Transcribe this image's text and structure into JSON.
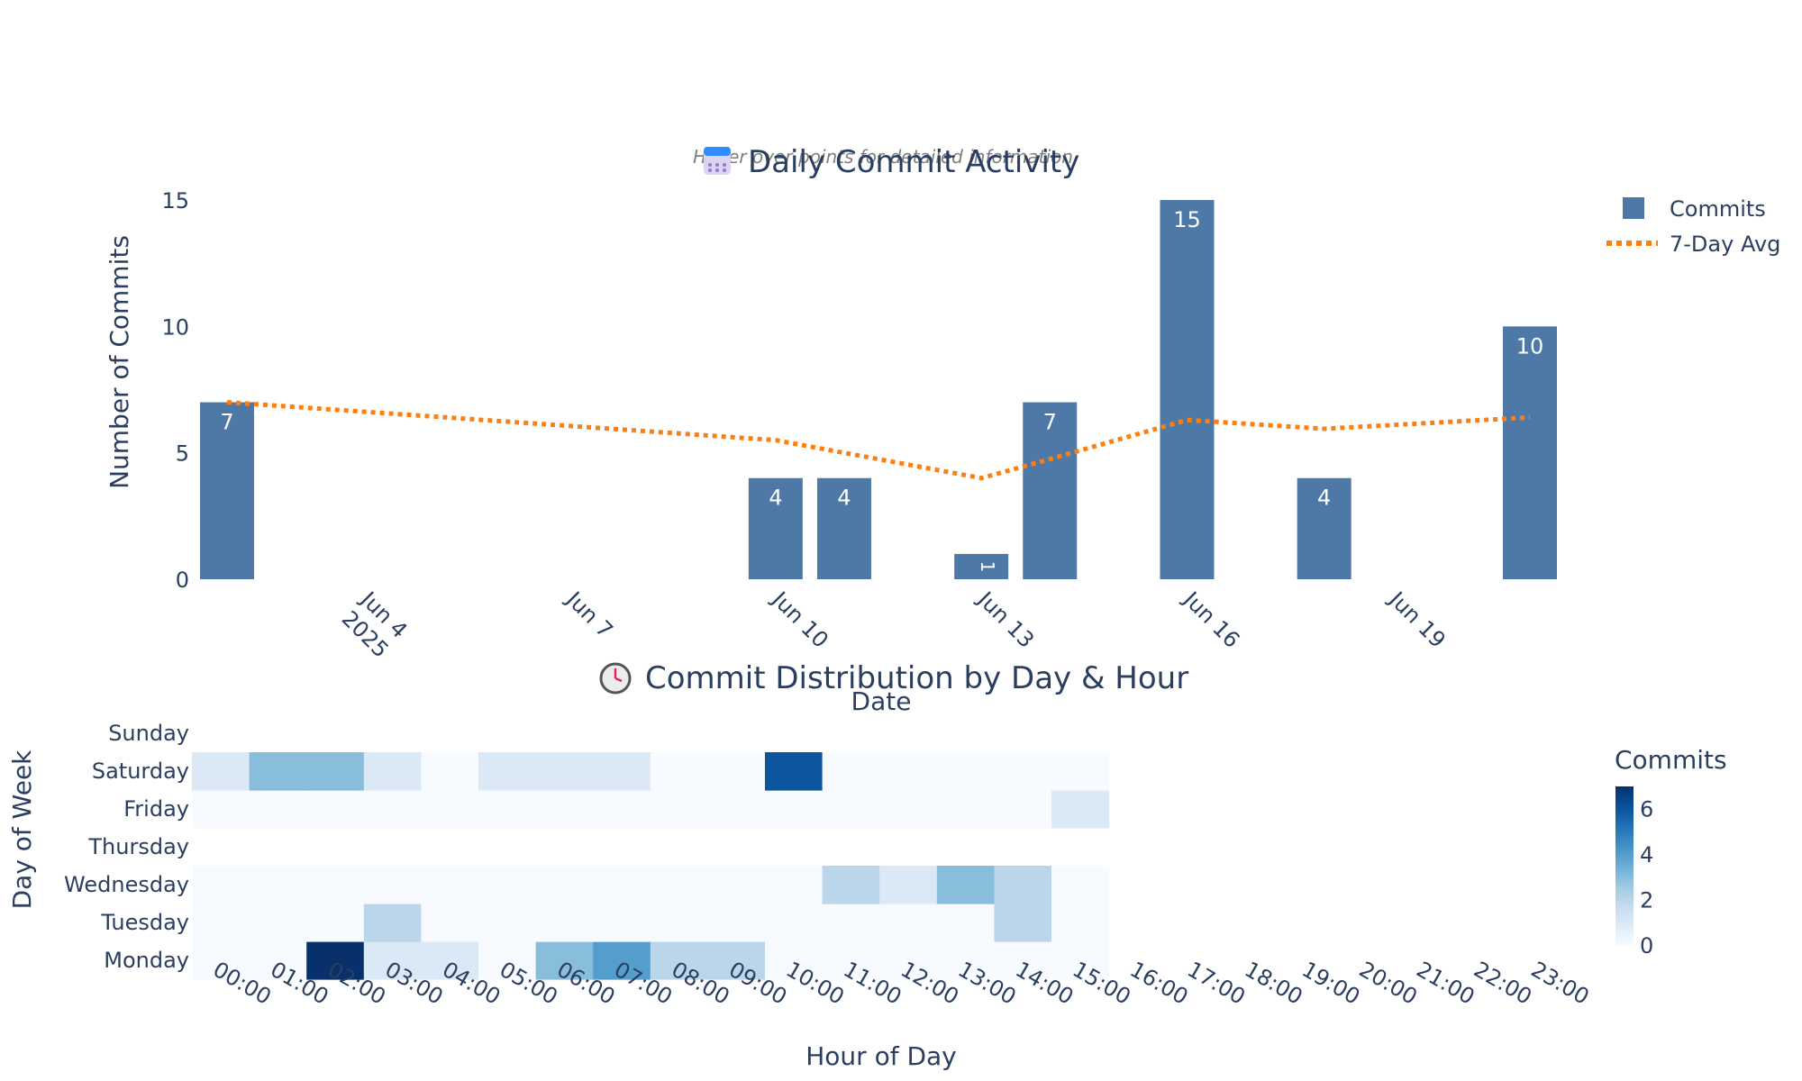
{
  "charts": {
    "bar": {
      "title": "Daily Commit Activity",
      "title_icon": "calendar-icon",
      "subtitle": "Hover over points for detailed information",
      "xlabel": "Date",
      "ylabel": "Number of Commits",
      "legend": [
        "Commits",
        "7-Day Avg"
      ]
    },
    "heatmap": {
      "title": "Commit Distribution by Day & Hour",
      "title_icon": "clock-icon",
      "xlabel": "Hour of Day",
      "ylabel": "Day of Week",
      "colorbar_title": "Commits"
    }
  },
  "chart_data": [
    {
      "type": "bar",
      "title": "Daily Commit Activity",
      "subtitle": "Hover over points for detailed information",
      "xlabel": "Date",
      "ylabel": "Number of Commits",
      "x_ticks": [
        "Jun 4\n2025",
        "Jun 7",
        "Jun 10",
        "Jun 13",
        "Jun 16",
        "Jun 19"
      ],
      "x_tick_dates": [
        "2025-06-04",
        "2025-06-07",
        "2025-06-10",
        "2025-06-13",
        "2025-06-16",
        "2025-06-19"
      ],
      "ylim": [
        0,
        15
      ],
      "y_ticks": [
        0,
        5,
        10,
        15
      ],
      "grid": true,
      "legend_position": "top-right",
      "series": [
        {
          "name": "Commits",
          "kind": "bar",
          "color": "#4e79a7",
          "x": [
            "2025-06-02",
            "2025-06-10",
            "2025-06-11",
            "2025-06-13",
            "2025-06-14",
            "2025-06-16",
            "2025-06-18",
            "2025-06-21"
          ],
          "values": [
            7,
            4,
            4,
            1,
            7,
            15,
            4,
            10
          ],
          "labels": [
            "7",
            "4",
            "4",
            "1",
            "7",
            "15",
            "4",
            "10"
          ]
        },
        {
          "name": "7-Day Avg",
          "kind": "line",
          "style": "dotted",
          "color": "#ff7f0e",
          "x": [
            "2025-06-02",
            "2025-06-10",
            "2025-06-11",
            "2025-06-13",
            "2025-06-14",
            "2025-06-16",
            "2025-06-18",
            "2025-06-21"
          ],
          "values": [
            7.0,
            5.5,
            5.0,
            4.0,
            4.75,
            6.3,
            5.95,
            6.4
          ]
        }
      ]
    },
    {
      "type": "heatmap",
      "title": "Commit Distribution by Day & Hour",
      "xlabel": "Hour of Day",
      "ylabel": "Day of Week",
      "colorscale": "Blues",
      "zlim": [
        0,
        7
      ],
      "colorbar_ticks": [
        0,
        2,
        4,
        6
      ],
      "x": [
        "00:00",
        "01:00",
        "02:00",
        "03:00",
        "04:00",
        "05:00",
        "06:00",
        "07:00",
        "08:00",
        "09:00",
        "10:00",
        "11:00",
        "12:00",
        "13:00",
        "14:00",
        "15:00",
        "16:00",
        "17:00",
        "18:00",
        "19:00",
        "20:00",
        "21:00",
        "22:00",
        "23:00"
      ],
      "y": [
        "Monday",
        "Tuesday",
        "Wednesday",
        "Thursday",
        "Friday",
        "Saturday",
        "Sunday"
      ],
      "z": [
        [
          0,
          0,
          7,
          1,
          1,
          0,
          3,
          4,
          2,
          2,
          0,
          0,
          0,
          0,
          0,
          0
        ],
        [
          0,
          0,
          0,
          2,
          0,
          0,
          0,
          0,
          0,
          0,
          0,
          0,
          0,
          0,
          2,
          0
        ],
        [
          0,
          0,
          0,
          0,
          0,
          0,
          0,
          0,
          0,
          0,
          0,
          2,
          1,
          3,
          2,
          0
        ],
        [
          null,
          null,
          null,
          null,
          null,
          null,
          null,
          null,
          null,
          null,
          null,
          null,
          null,
          null,
          null,
          null
        ],
        [
          0,
          0,
          0,
          0,
          0,
          0,
          0,
          0,
          0,
          0,
          0,
          0,
          0,
          0,
          0,
          1
        ],
        [
          1,
          3,
          3,
          1,
          0,
          1,
          1,
          1,
          0,
          0,
          6,
          0,
          0,
          0,
          0,
          0
        ],
        [
          null,
          null,
          null,
          null,
          null,
          null,
          null,
          null,
          null,
          null,
          null,
          null,
          null,
          null,
          null,
          null
        ]
      ]
    }
  ]
}
